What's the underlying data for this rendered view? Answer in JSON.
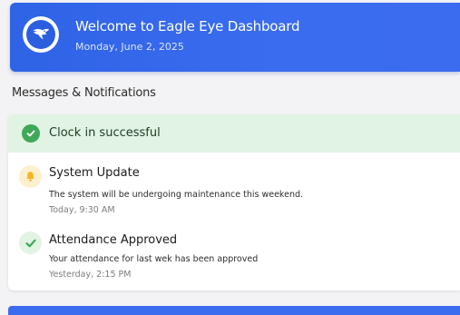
{
  "header": {
    "title": "Welcome to Eagle Eye Dashboard",
    "date": "Monday, June 2, 2025",
    "logo_icon": "eagle-icon",
    "accent": "#3a6cf0"
  },
  "messages": {
    "section_title": "Messages & Notifications",
    "banner": {
      "text": "Clock in successful",
      "icon": "check-circle-icon",
      "color": "#3fa85a"
    },
    "items": [
      {
        "title": "System Update",
        "description": "The system will be undergoing maintenance this weekend.",
        "time": "Today, 9:30 AM",
        "icon": "bell-icon",
        "icon_color": "#f5b622"
      },
      {
        "title": "Attendance Approved",
        "description": "Your attendance for last wek has been approved",
        "time": "Yesterday, 2:15 PM",
        "icon": "check-icon",
        "icon_color": "#3fa85a"
      }
    ]
  }
}
